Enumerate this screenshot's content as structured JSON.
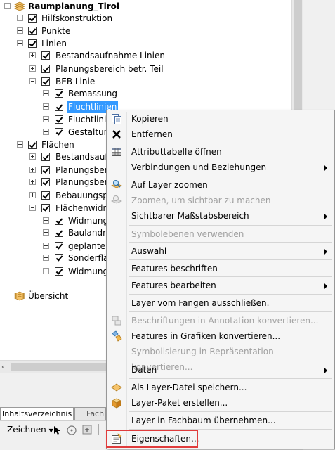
{
  "toc": {
    "root_label": "Raumplanung_Tirol",
    "groups": [
      {
        "label": "Hilfskonstruktion"
      },
      {
        "label": "Punkte"
      },
      {
        "label": "Linien"
      },
      {
        "label": "Bestandsaufnahme Linien"
      },
      {
        "label": "Planungsbereich betr. Teil"
      },
      {
        "label": "BEB Linie"
      },
      {
        "label": "Bemassung"
      },
      {
        "label": "Fluchtlinien"
      },
      {
        "label": "Fluchtlinie"
      },
      {
        "label": "Gestaltung"
      },
      {
        "label": "Flächen"
      },
      {
        "label": "Bestandsaufn"
      },
      {
        "label": "Planungsbere"
      },
      {
        "label": "Planungsbere"
      },
      {
        "label": "Bebauungspla"
      },
      {
        "label": "Flächenwidm"
      },
      {
        "label": "Widmung"
      },
      {
        "label": "Baulandre"
      },
      {
        "label": "geplante V"
      },
      {
        "label": "Sonderfläc"
      },
      {
        "label": "Widmung"
      }
    ],
    "overview_label": "Übersicht"
  },
  "tabs": {
    "toc_tab": "Inhaltsverzeichnis",
    "fach_tab": "Fach"
  },
  "draw_toolbar": {
    "label": "Zeichnen"
  },
  "context_menu": {
    "items": [
      {
        "label": "Kopieren",
        "icon": "copy-icon",
        "enabled": true
      },
      {
        "label": "Entfernen",
        "icon": "remove-x-icon",
        "enabled": true
      },
      {
        "label": "Attributtabelle öffnen",
        "icon": "table-icon",
        "enabled": true
      },
      {
        "label": "Verbindungen und Beziehungen",
        "enabled": true,
        "submenu": true
      },
      {
        "label": "Auf Layer zoomen",
        "icon": "zoom-layer-icon",
        "enabled": true
      },
      {
        "label": "Zoomen, um sichtbar zu machen",
        "icon": "zoom-visible-icon",
        "enabled": false
      },
      {
        "label": "Sichtbarer Maßstabsbereich",
        "enabled": true,
        "submenu": true
      },
      {
        "label": "Symbolebenen verwenden",
        "enabled": false
      },
      {
        "label": "Auswahl",
        "enabled": true,
        "submenu": true
      },
      {
        "label": "Features beschriften",
        "enabled": true
      },
      {
        "label": "Features bearbeiten",
        "enabled": true,
        "submenu": true
      },
      {
        "label": "Layer vom Fangen ausschließen.",
        "enabled": true
      },
      {
        "label": "Beschriftungen in Annotation konvertieren...",
        "icon": "annotation-icon",
        "enabled": false
      },
      {
        "label": "Features in Grafiken konvertieren...",
        "icon": "graphics-convert-icon",
        "enabled": true
      },
      {
        "label": "Symbolisierung in Repräsentation konvertieren...",
        "enabled": false
      },
      {
        "label": "Daten",
        "enabled": true,
        "submenu": true
      },
      {
        "label": "Als Layer-Datei speichern...",
        "icon": "layer-file-icon",
        "enabled": true
      },
      {
        "label": "Layer-Paket erstellen...",
        "icon": "layer-package-icon",
        "enabled": true
      },
      {
        "label": "Layer in Fachbaum übernehmen...",
        "enabled": true
      },
      {
        "label": "Eigenschaften...",
        "icon": "properties-icon",
        "enabled": true
      }
    ]
  },
  "colors": {
    "selection": "#3399ff",
    "highlight_box": "#e03c3c",
    "disabled_text": "#a0a0a0"
  }
}
